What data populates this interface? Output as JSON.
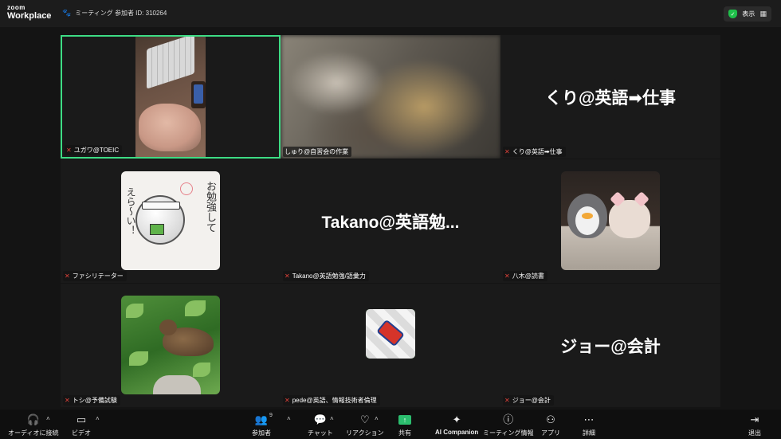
{
  "app": {
    "logo_line1": "zoom",
    "logo_line2": "Workplace"
  },
  "header": {
    "meeting_label": "ミーティング 参加者 ID: 310264",
    "view_label": "表示"
  },
  "tiles": [
    {
      "name": "ユガワ@TOEIC",
      "big_label": ""
    },
    {
      "name": "しゅり@自習会の作業",
      "big_label": ""
    },
    {
      "name": "くり@英語➡仕事",
      "big_label": "くり@英語➡仕事"
    },
    {
      "name": "ファシリテーター",
      "big_label": ""
    },
    {
      "name": "Takano@英語勉強/語彙力",
      "big_label": "Takano@英語勉..."
    },
    {
      "name": "八木@読書",
      "big_label": ""
    },
    {
      "name": "トシ@予備試験",
      "big_label": ""
    },
    {
      "name": "pede@英語、情報技術者倫理",
      "big_label": ""
    },
    {
      "name": "ジョー@会計",
      "big_label": "ジョー@会計"
    }
  ],
  "avatar_text": {
    "vertical_main": "お勉強して",
    "vertical_side": "えら〜い！"
  },
  "toolbar": {
    "audio": "オーディオに接続",
    "video": "ビデオ",
    "participants": "参加者",
    "participants_count": "9",
    "chat": "チャット",
    "reactions": "リアクション",
    "share": "共有",
    "ai": "AI Companion",
    "info": "ミーティング情報",
    "apps": "アプリ",
    "more": "詳細",
    "leave": "退出"
  },
  "colors": {
    "active_speaker": "#3ddc84",
    "share_green": "#2bbd6e",
    "leave_red": "#e0413a"
  }
}
